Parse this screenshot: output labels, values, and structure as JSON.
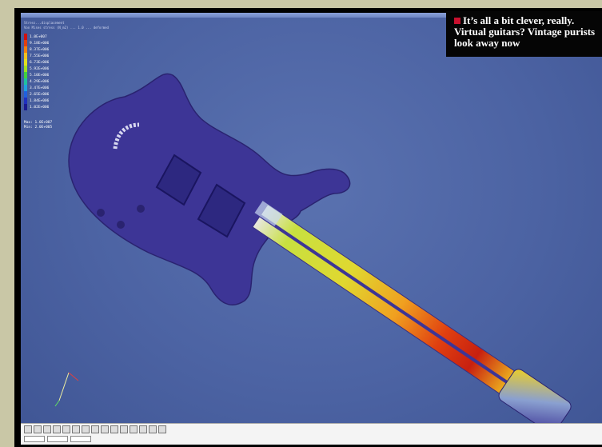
{
  "caption": {
    "text": "It’s all a bit clever, really. Virtual guitars? Vintage purists look away now",
    "bullet_color": "#c8102e"
  },
  "software": {
    "info_lines": [
      "Stress...displacement",
      "Von Mises stress (N_m2) ... 1.0 ... deformed"
    ],
    "legend": [
      {
        "color": "#d01010",
        "label": "1.0E+007"
      },
      {
        "color": "#e04010",
        "label": "9.18E+006"
      },
      {
        "color": "#f08010",
        "label": "8.37E+006"
      },
      {
        "color": "#f0c020",
        "label": "7.55E+006"
      },
      {
        "color": "#e0e020",
        "label": "6.73E+006"
      },
      {
        "color": "#a0e020",
        "label": "5.92E+006"
      },
      {
        "color": "#40d040",
        "label": "5.10E+006"
      },
      {
        "color": "#20c0a0",
        "label": "4.29E+006"
      },
      {
        "color": "#20a0e0",
        "label": "3.47E+006"
      },
      {
        "color": "#2060e0",
        "label": "2.65E+006"
      },
      {
        "color": "#2030c0",
        "label": "1.84E+006"
      },
      {
        "color": "#1a1a90",
        "label": "1.02E+006"
      }
    ],
    "legend_foot": [
      "Max: 1.0E+007",
      "Min: 2.0E+005"
    ],
    "model_color": "#3d3596",
    "background_color": "#4c63a3"
  },
  "toolbar": {
    "button_icons": [
      "arrow-icon",
      "rotate-icon",
      "pan-icon",
      "zoom-icon",
      "fit-icon",
      "select-icon",
      "view-icon",
      "axis-icon",
      "render-icon",
      "mesh-icon",
      "deform-icon",
      "anim-icon",
      "play-icon",
      "stop-icon",
      "measure-icon"
    ]
  }
}
